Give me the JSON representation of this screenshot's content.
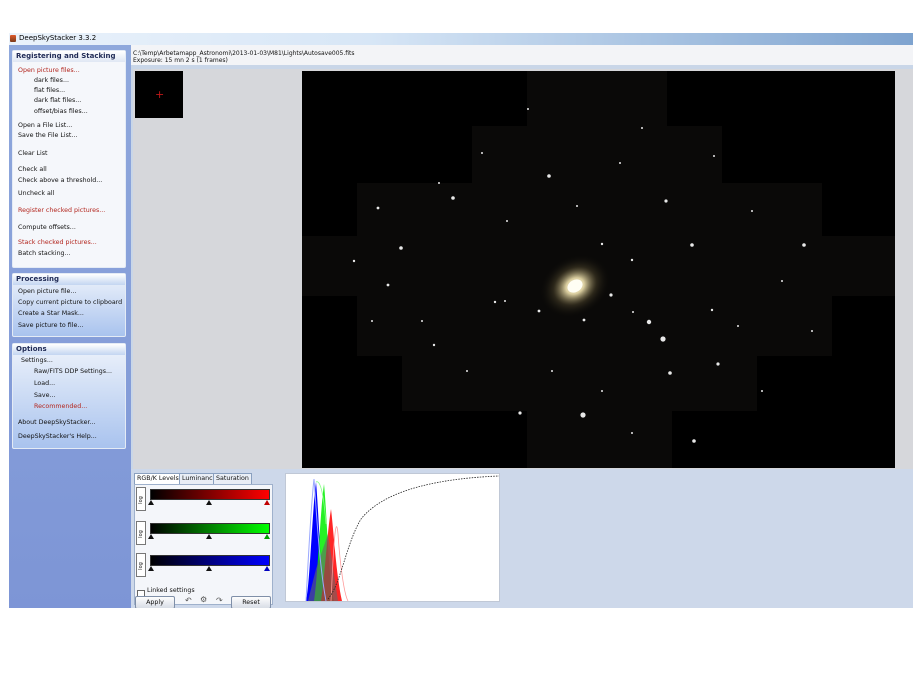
{
  "window": {
    "title": "DeepSkyStacker 3.3.2"
  },
  "sidebar": {
    "registering": {
      "title": "Registering and Stacking",
      "items": [
        {
          "label": "Open picture files...",
          "red": true
        },
        {
          "label": "dark files..."
        },
        {
          "label": "flat files..."
        },
        {
          "label": "dark flat files..."
        },
        {
          "label": "offset/bias files..."
        },
        {
          "label": "Open a File List..."
        },
        {
          "label": "Save the File List..."
        },
        {
          "label": "Clear List"
        },
        {
          "label": "Check all"
        },
        {
          "label": "Check above a threshold..."
        },
        {
          "label": "Uncheck all"
        },
        {
          "label": "Register checked pictures...",
          "red": true
        },
        {
          "label": "Compute offsets..."
        },
        {
          "label": "Stack checked pictures...",
          "red": true
        },
        {
          "label": "Batch stacking..."
        }
      ]
    },
    "processing": {
      "title": "Processing",
      "items": [
        {
          "label": "Open picture file..."
        },
        {
          "label": "Copy current picture to clipboard"
        },
        {
          "label": "Create a Star Mask..."
        },
        {
          "label": "Save picture to file..."
        }
      ]
    },
    "options": {
      "title": "Options",
      "items": [
        {
          "label": "Settings..."
        },
        {
          "label": "Raw/FITS DDP Settings..."
        },
        {
          "label": "Load..."
        },
        {
          "label": "Save..."
        },
        {
          "label": "Recommended...",
          "red": true
        },
        {
          "label": "About DeepSkyStacker..."
        },
        {
          "label": "DeepSkyStacker's Help..."
        }
      ]
    }
  },
  "file_info": {
    "path": "C:\\Temp\\Arbetamapp_Astronomi\\2013-01-03\\M81\\Lights\\Autosave005.fits",
    "exposure": "Exposure: 15 mn 2 s (1 frames)"
  },
  "levels": {
    "tabs": [
      "RGB/K Levels",
      "Luminance",
      "Saturation"
    ],
    "active_tab": "RGB/K Levels",
    "log_label": "log",
    "linked_label": "Linked settings",
    "apply_label": "Apply",
    "reset_label": "Reset",
    "channels": [
      {
        "name": "red",
        "color": "#ff0000"
      },
      {
        "name": "green",
        "color": "#00ff00"
      },
      {
        "name": "blue",
        "color": "#0000ff"
      }
    ],
    "marker_positions": {
      "black": 0.0,
      "mid": 0.5,
      "white": 1.0
    }
  },
  "colors": {
    "sidebar_red_text": "#b3261e",
    "image_background": "#000000"
  }
}
